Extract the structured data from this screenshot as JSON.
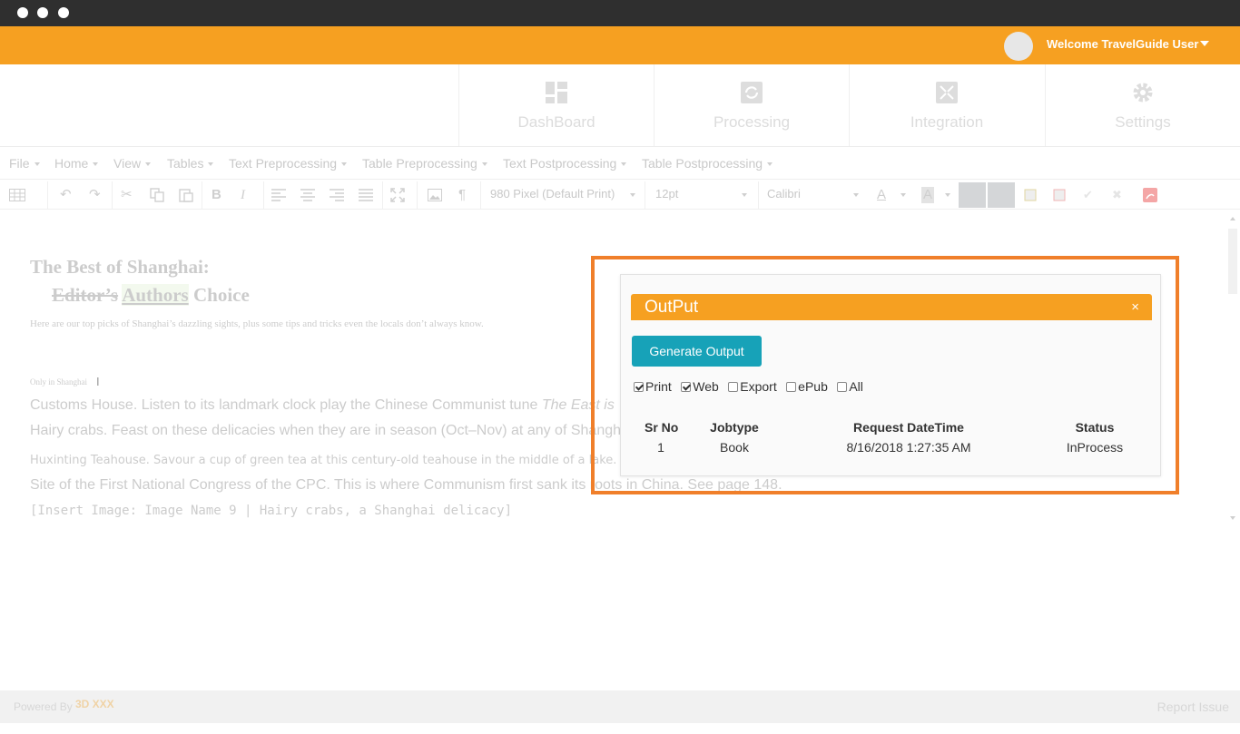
{
  "header": {
    "welcome_text": "Welcome TravelGuide User"
  },
  "nav": [
    {
      "label": "DashBoard",
      "icon": "dashboard-icon"
    },
    {
      "label": "Processing",
      "icon": "processing-icon"
    },
    {
      "label": "Integration",
      "icon": "integration-icon"
    },
    {
      "label": "Settings",
      "icon": "gear-icon"
    }
  ],
  "menu": [
    "File",
    "Home",
    "View",
    "Tables",
    "Text Preprocessing",
    "Table Preprocessing",
    "Text Postprocessing",
    "Table Postprocessing"
  ],
  "toolbar": {
    "page_width": "980 Pixel (Default Print)",
    "font_size": "12pt",
    "font_family": "Calibri",
    "bold": "B",
    "italic": "I",
    "pilcrow": "¶",
    "font_color_glyph": "A",
    "bg_color_glyph": "A"
  },
  "document": {
    "title": "The Best of Shanghai:",
    "subtitle_deleted": "Editor’s",
    "subtitle_inserted": "Authors",
    "subtitle_rest": "Choice",
    "intro": "Here are our top picks of Shanghai’s dazzling sights, plus some tips and tricks even the locals don’t always know.",
    "section_label": "Only in Shanghai",
    "line1_a": "Customs House. Listen to its landmark clock play the Chinese Communist tune ",
    "line1_b": "The East is",
    "line2": "Hairy crabs. Feast on these delicacies when they are in season (Oct–Nov) at any of Shangh",
    "line3": "Huxinting Teahouse. Savour a cup of green tea at this century-old teahouse in the middle of a lake. Se",
    "line4": "Site of the First National Congress of the CPC. This is where Communism first sank its roots in China. See page 148.",
    "line5": "[Insert Image: Image Name 9 | Hairy crabs, a Shanghai delicacy]"
  },
  "output_dialog": {
    "title": "OutPut",
    "close": "×",
    "generate_button": "Generate Output",
    "checkboxes": [
      {
        "label": "Print",
        "checked": true
      },
      {
        "label": "Web",
        "checked": true
      },
      {
        "label": "Export",
        "checked": false
      },
      {
        "label": "ePub",
        "checked": false
      },
      {
        "label": "All",
        "checked": false
      }
    ],
    "columns": [
      "Sr No",
      "Jobtype",
      "Request DateTime",
      "Status"
    ],
    "rows": [
      {
        "sr": "1",
        "jobtype": "Book",
        "datetime": "8/16/2018 1:27:35 AM",
        "status": "InProcess"
      }
    ]
  },
  "footer": {
    "powered_by": "Powered By",
    "logo_text": "3D XXX",
    "report_issue": "Report Issue"
  },
  "colors": {
    "accent": "#f6a021",
    "highlight_border": "#f07f2a",
    "button": "#17a2b8",
    "titlebar": "#2f2f2f"
  }
}
